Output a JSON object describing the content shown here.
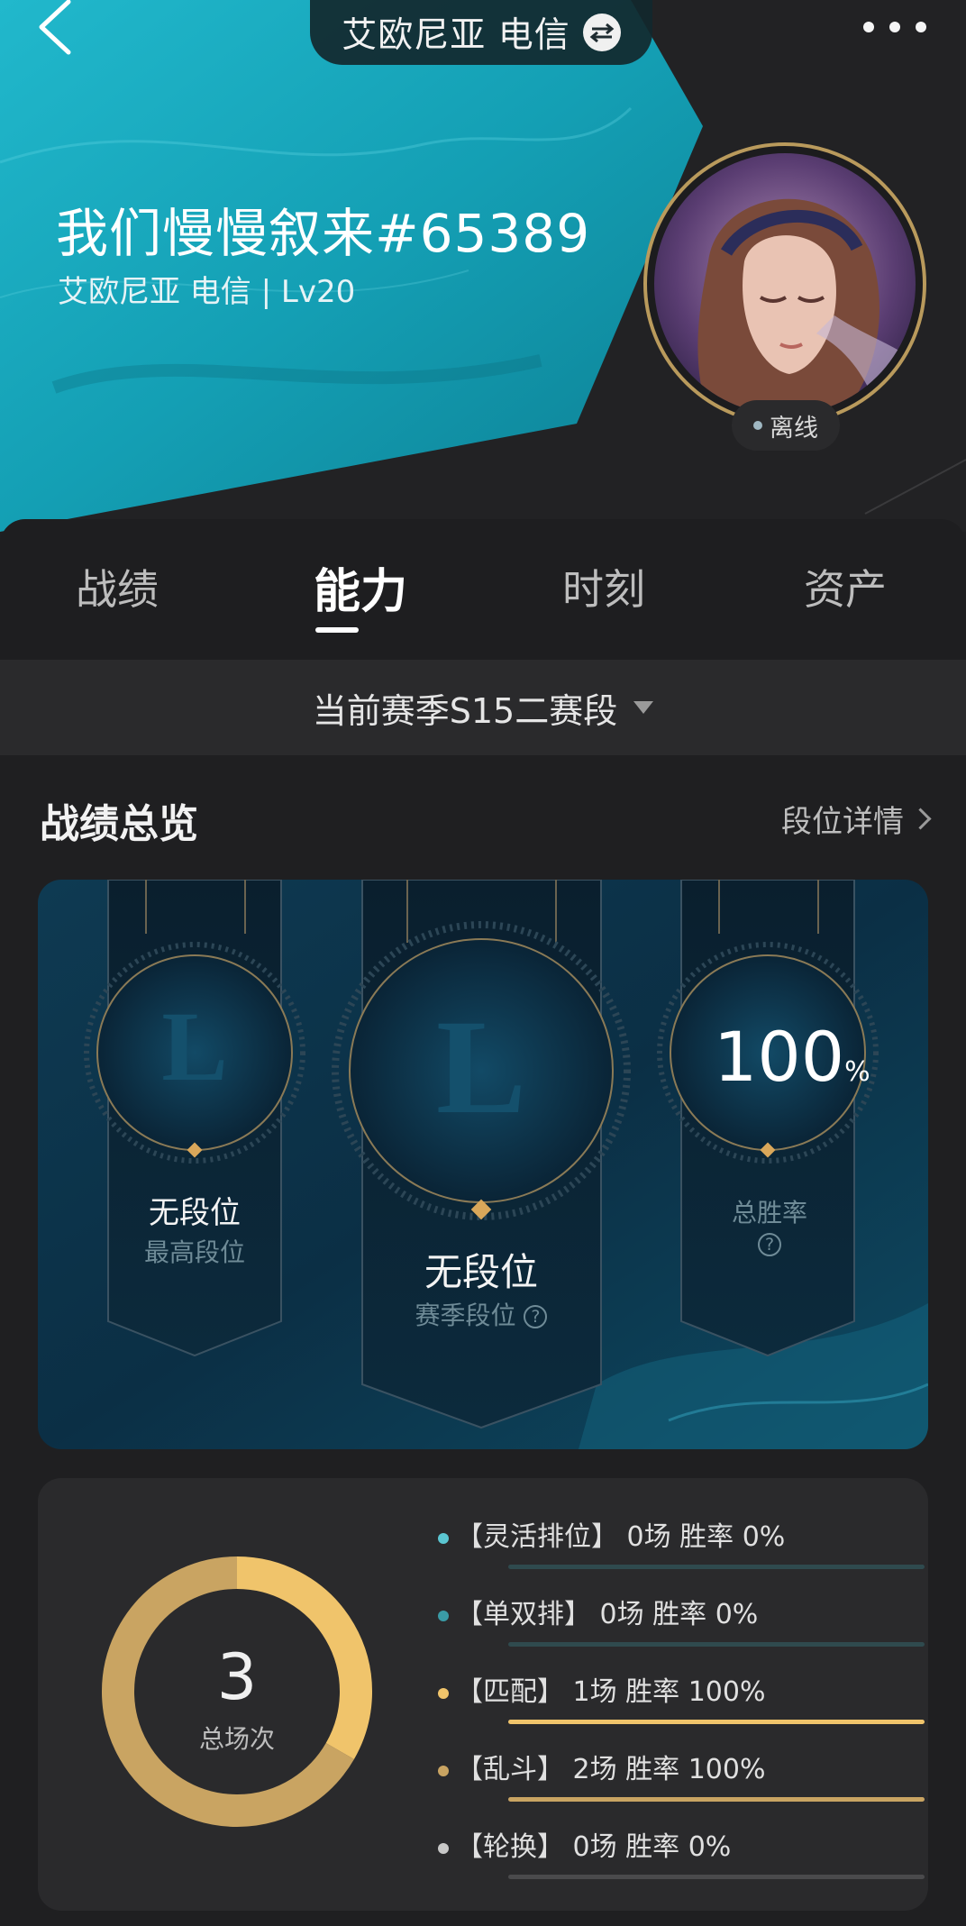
{
  "header": {
    "server": "艾欧尼亚 电信",
    "player_name": "我们慢慢叙来#65389",
    "player_sub": "艾欧尼亚 电信 | Lv20",
    "status": "离线"
  },
  "tabs": [
    {
      "label": "战绩",
      "active": false
    },
    {
      "label": "能力",
      "active": true
    },
    {
      "label": "时刻",
      "active": false
    },
    {
      "label": "资产",
      "active": false
    }
  ],
  "season_selector": "当前赛季S15二赛段",
  "overview": {
    "title": "战绩总览",
    "detail_link": "段位详情",
    "highest_rank": {
      "value": "无段位",
      "label": "最高段位"
    },
    "season_rank": {
      "value": "无段位",
      "label": "赛季段位"
    },
    "win_rate": {
      "value": "100",
      "unit": "%",
      "label": "总胜率"
    }
  },
  "stats": {
    "total": "3",
    "total_label": "总场次",
    "modes": [
      {
        "text": "【灵活排位】 0场  胜率 0%",
        "games": 0,
        "win_rate": 0,
        "color": "#5bc6d2"
      },
      {
        "text": "【单双排】 0场  胜率 0%",
        "games": 0,
        "win_rate": 0,
        "color": "#3a9ba6"
      },
      {
        "text": "【匹配】 1场  胜率 100%",
        "games": 1,
        "win_rate": 100,
        "color": "#f0c46b"
      },
      {
        "text": "【乱斗】 2场  胜率 100%",
        "games": 2,
        "win_rate": 100,
        "color": "#c9a462"
      },
      {
        "text": "【轮换】 0场  胜率 0%",
        "games": 0,
        "win_rate": 0,
        "color": "#c8c8c8"
      }
    ]
  },
  "colors": {
    "accent_gold": "#b99a5c",
    "teal": "#17a9bd",
    "background": "#1f1f21"
  },
  "icons": [
    "back-arrow-icon",
    "swap-icon",
    "more-icon",
    "caret-down-icon",
    "chevron-right-icon",
    "help-icon"
  ]
}
